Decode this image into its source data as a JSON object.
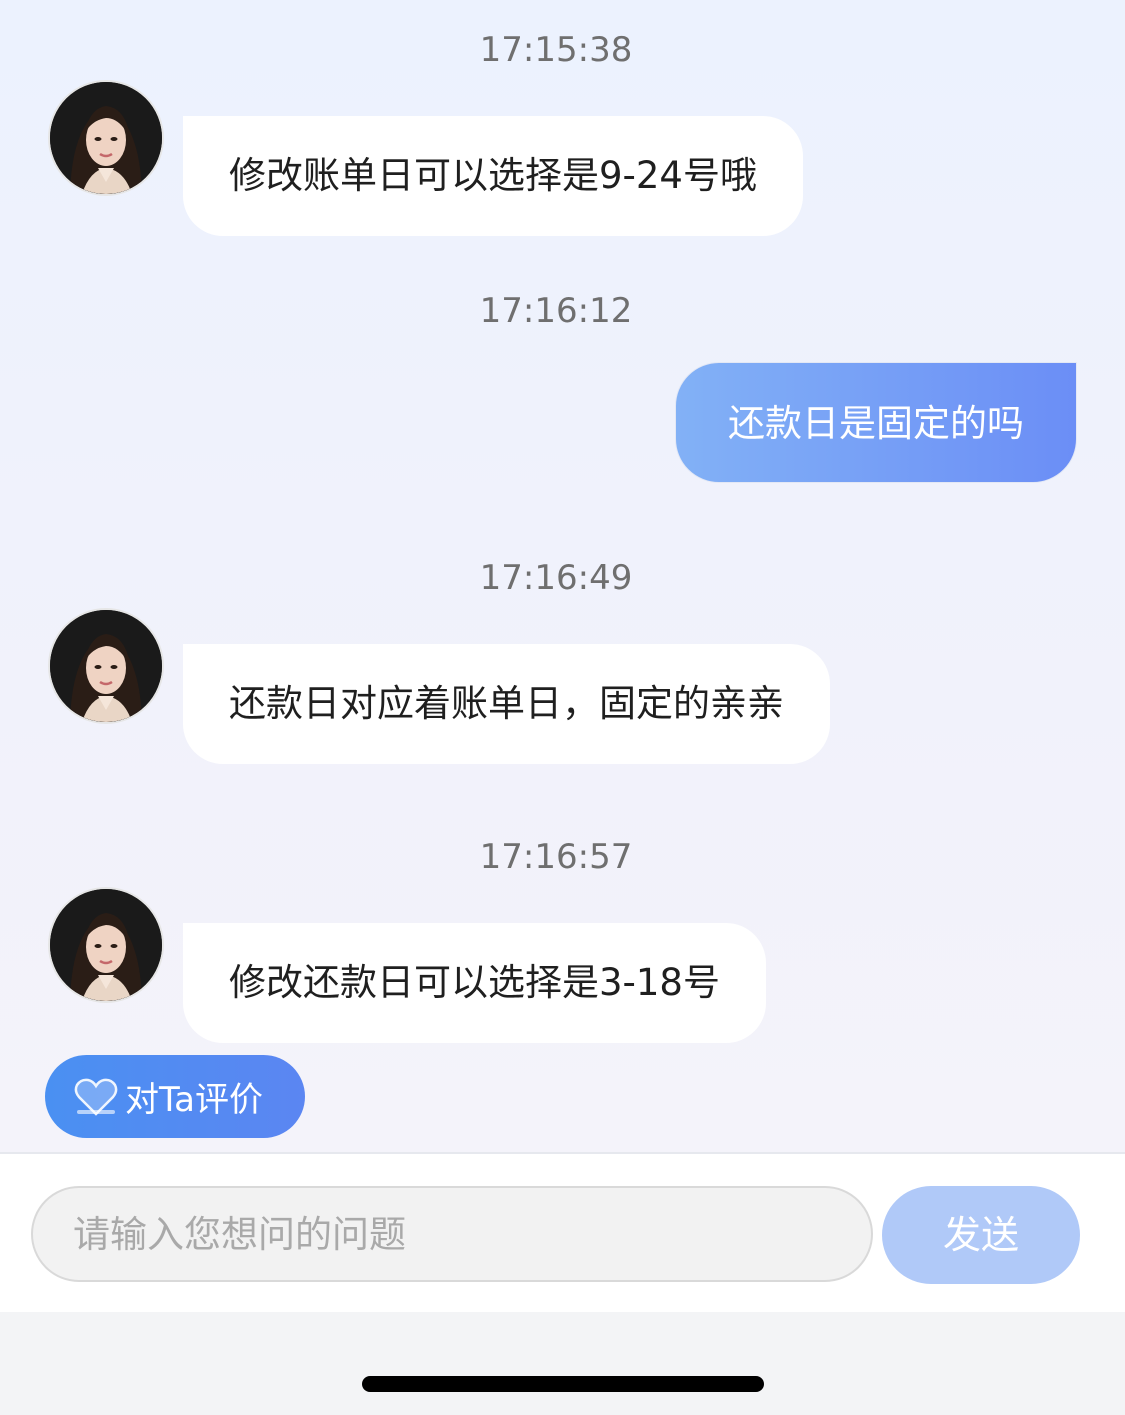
{
  "messages": [
    {
      "time": "17:15:38",
      "text": "修改账单日可以选择是9-24号哦"
    },
    {
      "time": "17:16:12",
      "text": "还款日是固定的吗"
    },
    {
      "time": "17:16:49",
      "text": "还款日对应着账单日，固定的亲亲"
    },
    {
      "time": "17:16:57",
      "text": "修改还款日可以选择是3-18号"
    }
  ],
  "rate_button": {
    "label": "对Ta评价",
    "icon": "heart-icon"
  },
  "input": {
    "placeholder": "请输入您想问的问题",
    "value": ""
  },
  "send_button": {
    "label": "发送"
  },
  "colors": {
    "chat_bg": "#ecf2fe",
    "outgoing_bubble_start": "#82b1f6",
    "outgoing_bubble_end": "#6b8ef6",
    "send_button": "#b0c9f8",
    "rate_button": "#4a90f2"
  }
}
